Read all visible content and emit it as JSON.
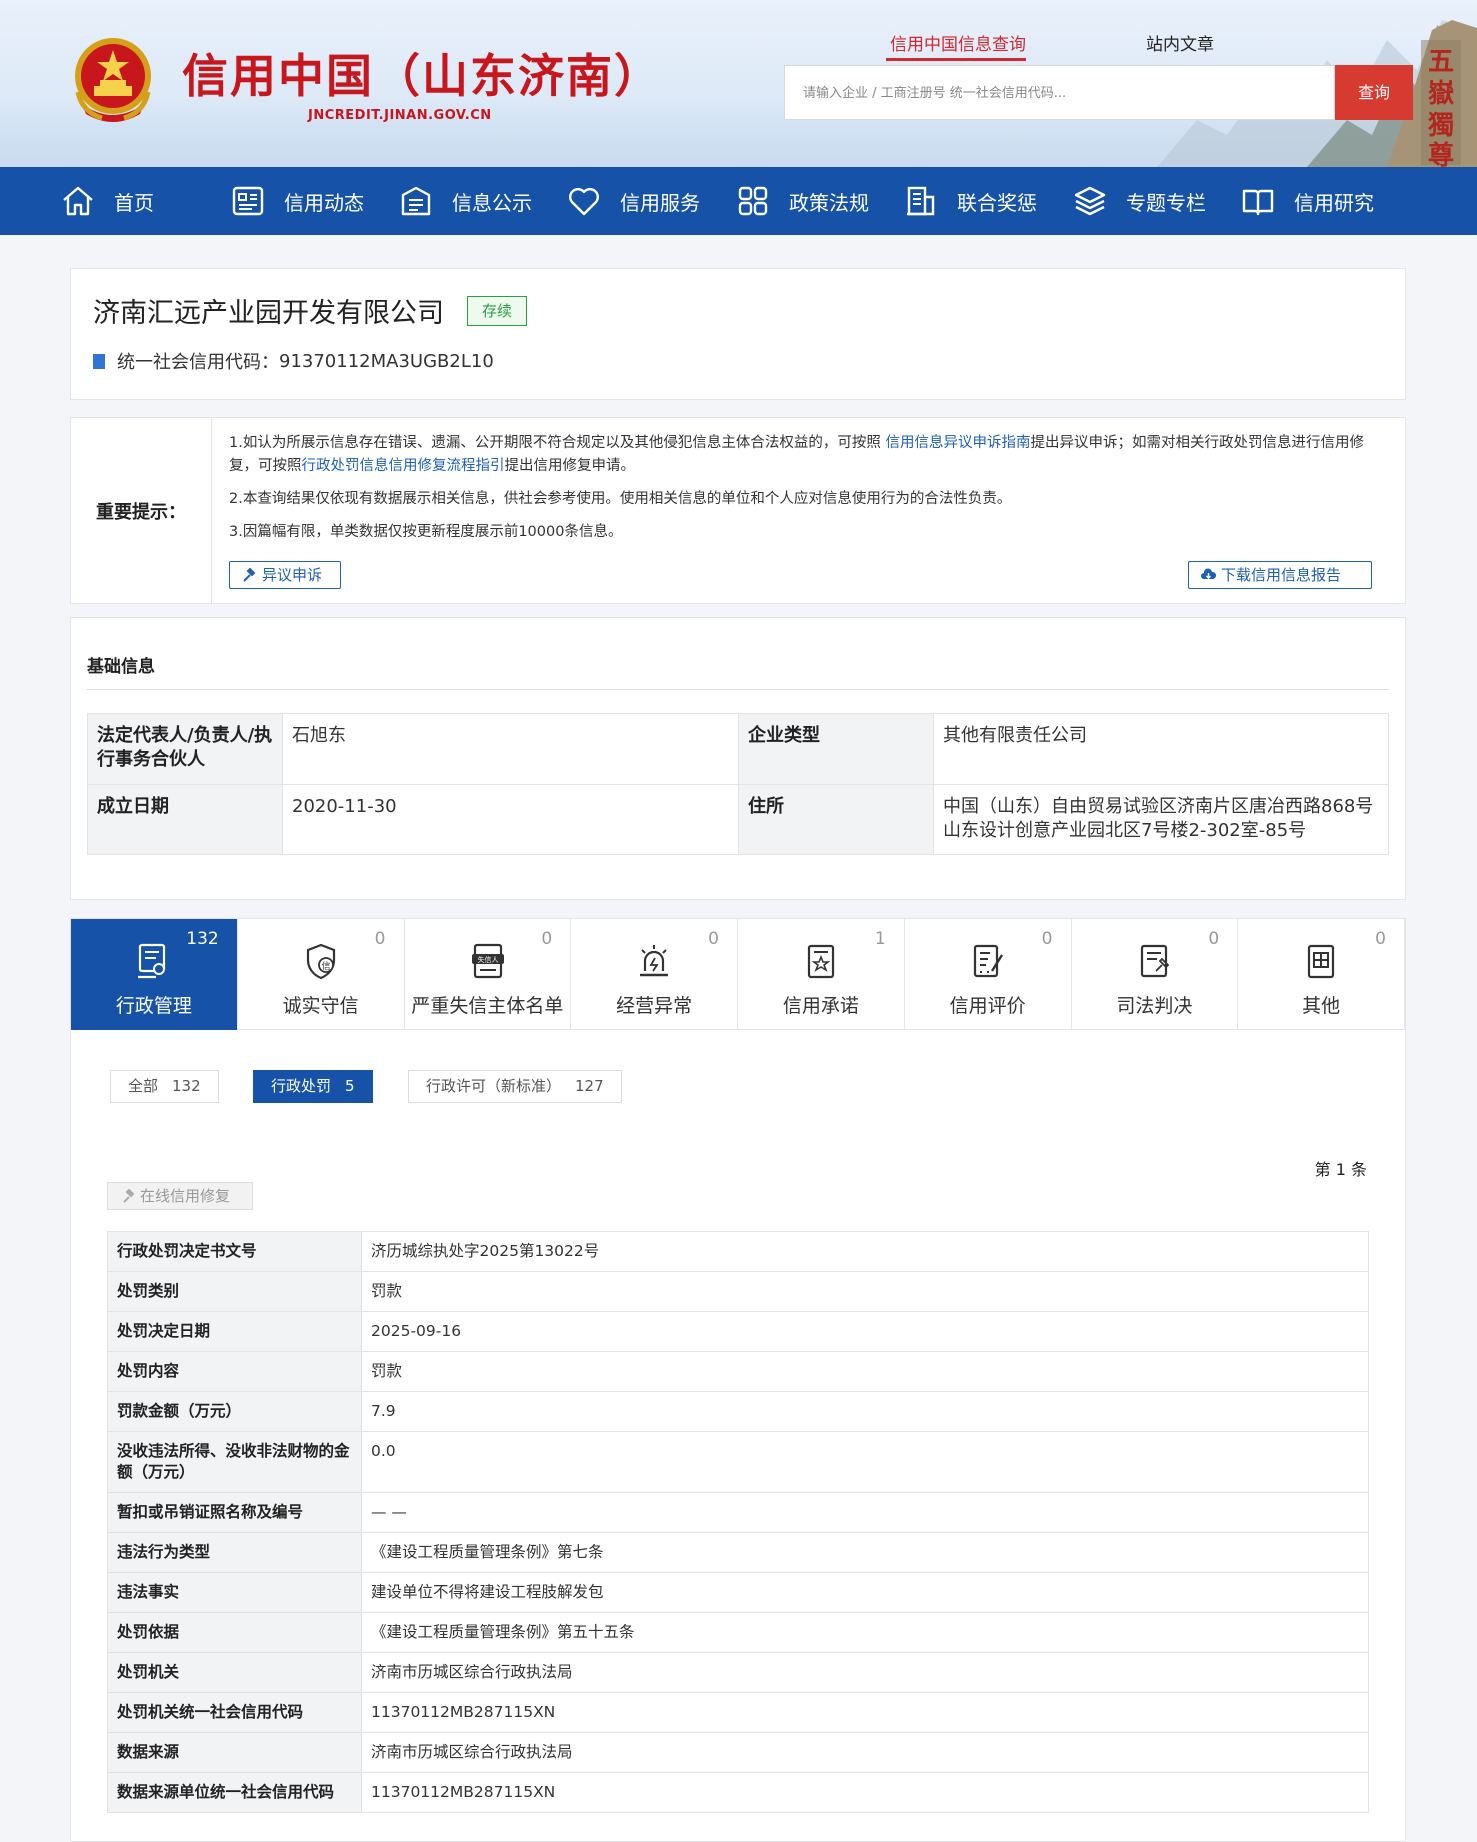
{
  "header": {
    "site_title": "信用中国（山东济南）",
    "site_domain": "JNCREDIT.JINAN.GOV.CN",
    "search_tabs": [
      "信用中国信息查询",
      "站内文章"
    ],
    "search_placeholder": "请输入企业 / 工商注册号 统一社会信用代码...",
    "search_button": "查询"
  },
  "nav": [
    {
      "label": "首页",
      "icon": "home-icon"
    },
    {
      "label": "信用动态",
      "icon": "news-icon"
    },
    {
      "label": "信息公示",
      "icon": "bulletin-icon"
    },
    {
      "label": "信用服务",
      "icon": "heart-icon"
    },
    {
      "label": "政策法规",
      "icon": "grid-icon"
    },
    {
      "label": "联合奖惩",
      "icon": "building-icon"
    },
    {
      "label": "专题专栏",
      "icon": "layers-icon"
    },
    {
      "label": "信用研究",
      "icon": "book-icon"
    }
  ],
  "company": {
    "name": "济南汇远产业园开发有限公司",
    "status": "存续",
    "credit_code_label": "统一社会信用代码：",
    "credit_code": "91370112MA3UGB2L10"
  },
  "notice": {
    "title": "重要提示：",
    "line1_a": "1.如认为所展示信息存在错误、遗漏、公开期限不符合规定以及其他侵犯信息主体合法权益的，可按照 ",
    "line1_link1": "信用信息异议申诉指南",
    "line1_b": "提出异议申诉；如需对相关行政处罚信息进行信用修复，可按照",
    "line1_link2": "行政处罚信息信用修复流程指引",
    "line1_c": "提出信用修复申请。",
    "line2": "2.本查询结果仅依现有数据展示相关信息，供社会参考使用。使用相关信息的单位和个人应对信息使用行为的合法性负责。",
    "line3": "3.因篇幅有限，单类数据仅按更新程度展示前10000条信息。",
    "appeal_button": "异议申诉",
    "download_button": "下载信用信息报告"
  },
  "basic": {
    "title": "基础信息",
    "rows": [
      [
        {
          "k": "法定代表人/负责人/执行事务合伙人",
          "v": "石旭东"
        },
        {
          "k": "企业类型",
          "v": "其他有限责任公司"
        }
      ],
      [
        {
          "k": "成立日期",
          "v": "2020-11-30"
        },
        {
          "k": "住所",
          "v": "中国（山东）自由贸易试验区济南片区唐冶西路868号山东设计创意产业园北区7号楼2-302室-85号"
        }
      ]
    ]
  },
  "tabs": [
    {
      "label": "行政管理",
      "count": "132"
    },
    {
      "label": "诚实守信",
      "count": "0"
    },
    {
      "label": "严重失信主体名单",
      "count": "0"
    },
    {
      "label": "经营异常",
      "count": "0"
    },
    {
      "label": "信用承诺",
      "count": "1"
    },
    {
      "label": "信用评价",
      "count": "0"
    },
    {
      "label": "司法判决",
      "count": "0"
    },
    {
      "label": "其他",
      "count": "0"
    }
  ],
  "blacklist_icon_text": "失信人",
  "credit_icon_text": "信",
  "filters": [
    {
      "label": "全部",
      "count": "132"
    },
    {
      "label": "行政处罚",
      "count": "5"
    },
    {
      "label": "行政许可（新标准）",
      "count": "127"
    }
  ],
  "pager_text": "第 1 条",
  "repair_button": "在线信用修复",
  "record": [
    {
      "k": "行政处罚决定书文号",
      "v": "济历城综执处字2025第13022号"
    },
    {
      "k": "处罚类别",
      "v": "罚款"
    },
    {
      "k": "处罚决定日期",
      "v": "2025-09-16"
    },
    {
      "k": "处罚内容",
      "v": "罚款"
    },
    {
      "k": "罚款金额（万元）",
      "v": "7.9"
    },
    {
      "k": "没收违法所得、没收非法财物的金额（万元）",
      "v": "0.0"
    },
    {
      "k": "暂扣或吊销证照名称及编号",
      "v": "— —"
    },
    {
      "k": "违法行为类型",
      "v": "《建设工程质量管理条例》第七条"
    },
    {
      "k": "违法事实",
      "v": "建设单位不得将建设工程肢解发包"
    },
    {
      "k": "处罚依据",
      "v": "《建设工程质量管理条例》第五十五条"
    },
    {
      "k": "处罚机关",
      "v": "济南市历城区综合行政执法局"
    },
    {
      "k": "处罚机关统一社会信用代码",
      "v": "11370112MB287115XN"
    },
    {
      "k": "数据来源",
      "v": "济南市历城区综合行政执法局"
    },
    {
      "k": "数据来源单位统一社会信用代码",
      "v": "11370112MB287115XN"
    }
  ],
  "colors": {
    "primary": "#1552a8",
    "brand_red": "#c8161d",
    "status_green": "#2aa13f"
  }
}
